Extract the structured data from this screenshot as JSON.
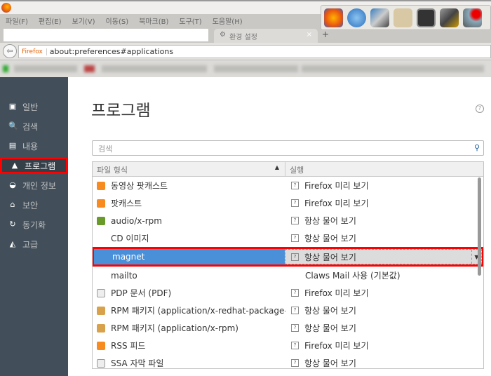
{
  "menu": [
    "파일(F)",
    "편집(E)",
    "보기(V)",
    "이동(S)",
    "북마크(B)",
    "도구(T)",
    "도움말(H)"
  ],
  "tab": {
    "title": "환경 설정",
    "close": "×",
    "new": "+"
  },
  "url": {
    "brand": "Firefox",
    "address": "about:preferences#applications",
    "back": "⇦"
  },
  "sidebar": [
    {
      "icon": "general",
      "label": "일반",
      "glyph": "▣"
    },
    {
      "icon": "search",
      "label": "검색",
      "glyph": "🔍"
    },
    {
      "icon": "content",
      "label": "내용",
      "glyph": "▤"
    },
    {
      "icon": "applications",
      "label": "프로그램",
      "glyph": "▲"
    },
    {
      "icon": "privacy",
      "label": "개인 정보",
      "glyph": "◒"
    },
    {
      "icon": "security",
      "label": "보안",
      "glyph": "⌂"
    },
    {
      "icon": "sync",
      "label": "동기화",
      "glyph": "↻"
    },
    {
      "icon": "advanced",
      "label": "고급",
      "glyph": "◭"
    }
  ],
  "main": {
    "title": "프로그램",
    "help": "?",
    "search_placeholder": "검색",
    "search_icon": "⚲"
  },
  "table": {
    "col_type": "파일 형식",
    "col_action": "실행",
    "sort": "▲",
    "rows": [
      {
        "icon": "rss",
        "type": "동영상 팟캐스트",
        "action": "Firefox 미리 보기",
        "ask": true
      },
      {
        "icon": "rss",
        "type": "팟캐스트",
        "action": "Firefox 미리 보기",
        "ask": true
      },
      {
        "icon": "music",
        "type": "audio/x-rpm",
        "action": "항상 물어 보기",
        "ask": true
      },
      {
        "icon": "none",
        "type": "CD 이미지",
        "action": "항상 물어 보기",
        "ask": true
      },
      {
        "icon": "none",
        "type": "magnet",
        "action": "항상 물어 보기",
        "ask": true,
        "selected": true
      },
      {
        "icon": "none",
        "type": "mailto",
        "action": "Claws Mail 사용 (기본값)",
        "ask": false
      },
      {
        "icon": "doc",
        "type": "PDP 문서 (PDF)",
        "action": "Firefox 미리 보기",
        "ask": true
      },
      {
        "icon": "pkg",
        "type": "RPM 패키지 (application/x-redhat-package-…",
        "action": "항상 물어 보기",
        "ask": true
      },
      {
        "icon": "pkg",
        "type": "RPM 패키지 (application/x-rpm)",
        "action": "항상 물어 보기",
        "ask": true
      },
      {
        "icon": "rss",
        "type": "RSS 피드",
        "action": "Firefox 미리 보기",
        "ask": true
      },
      {
        "icon": "doc",
        "type": "SSA 자막 파일",
        "action": "항상 물어 보기",
        "ask": true
      }
    ]
  },
  "dock": [
    "firefox",
    "qbittorrent",
    "video-editor",
    "folder",
    "terminal",
    "gimp",
    "network-app"
  ],
  "colors": {
    "sidebar": "#424f5a",
    "selected": "#4a90d9",
    "highlight": "#ff0000"
  }
}
